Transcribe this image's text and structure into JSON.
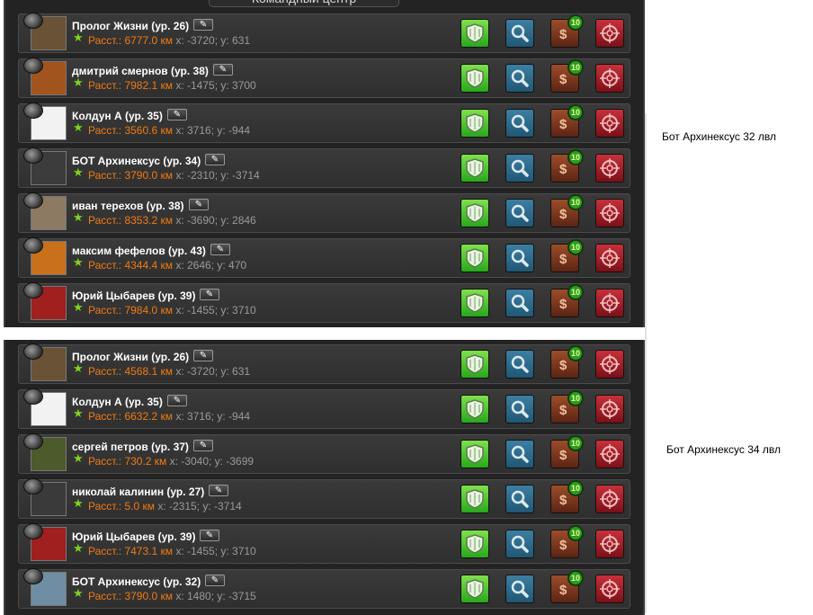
{
  "panel_title": "Командный центр",
  "notes": [
    "Бот Архинексус 32 лвл",
    "Бот Архинексус 34 лвл"
  ],
  "groups": [
    {
      "players": [
        {
          "name": "Пролог Жизни  (ур. 26)",
          "distance": "Расст.: 6777.0 км",
          "coords": "x: -3720; y: 631",
          "avatar": "#6a5236"
        },
        {
          "name": "дмитрий смернов  (ур. 38)",
          "distance": "Расст.: 7982.1 км",
          "coords": "x: -1475; y: 3700",
          "avatar": "#a2541e"
        },
        {
          "name": "Колдун А  (ур. 35)",
          "distance": "Расст.: 3560.6 км",
          "coords": "x: 3716; y: -944",
          "avatar": "#f2f2f2"
        },
        {
          "name": "БОТ Архинексус  (ур. 34)",
          "distance": "Расст.: 3790.0 км",
          "coords": "x: -2310; y: -3714",
          "avatar": "#3c3c3c"
        },
        {
          "name": "иван терехов  (ур. 38)",
          "distance": "Расст.: 8353.2 км",
          "coords": "x: -3690; y: 2846",
          "avatar": "#8c7a62"
        },
        {
          "name": "максим фефелов  (ур. 43)",
          "distance": "Расст.: 4344.4 км",
          "coords": "x: 2646; y: 470",
          "avatar": "#c8701c"
        },
        {
          "name": "Юрий Цыбарев  (ур. 39)",
          "distance": "Расст.: 7984.0 км",
          "coords": "x: -1455; y: 3710",
          "avatar": "#a01f1f"
        }
      ]
    },
    {
      "players": [
        {
          "name": "Пролог Жизни  (ур. 26)",
          "distance": "Расст.: 4568.1 км",
          "coords": "x: -3720; y: 631",
          "avatar": "#6a5236"
        },
        {
          "name": "Колдун А  (ур. 35)",
          "distance": "Расст.: 6632.2 км",
          "coords": "x: 3716; y: -944",
          "avatar": "#f2f2f2"
        },
        {
          "name": "сергей петров  (ур. 37)",
          "distance": "Расст.: 730.2 км",
          "coords": "x: -3040; y: -3699",
          "avatar": "#4c5a2c"
        },
        {
          "name": "николай калинин  (ур. 27)",
          "distance": "Расст.: 5.0 км",
          "coords": "x: -2315; y: -3714",
          "avatar": "#3a3a3a"
        },
        {
          "name": "Юрий Цыбарев  (ур. 39)",
          "distance": "Расст.: 7473.1 км",
          "coords": "x: -1455; y: 3710",
          "avatar": "#a01f1f"
        },
        {
          "name": "БОТ Архинексус  (ур. 32)",
          "distance": "Расст.: 3790.0 км",
          "coords": "x: 1480; y: -3715",
          "avatar": "#6f8ea3"
        }
      ]
    }
  ],
  "trade_count": "10",
  "trade_symbol": "$",
  "edit_symbol": "✎",
  "star_symbol": "★",
  "icons": [
    "shield-icon",
    "magnifier-icon",
    "trade-icon",
    "crosshair-icon"
  ]
}
